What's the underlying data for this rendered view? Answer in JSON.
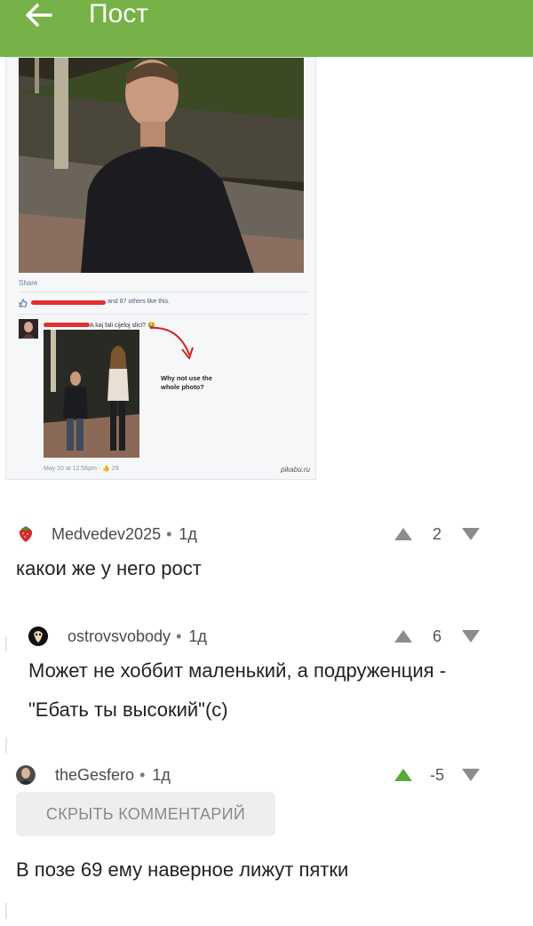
{
  "appbar": {
    "title": "Пост",
    "back_icon": "arrow-left-icon",
    "color": "#76b247"
  },
  "post_image": {
    "share_label": "Share",
    "like_text": "and 87 others like this.",
    "fb_comment": "A kaj fali cijeloj slici? 😂",
    "fb_meta": "May 10 at 12:56pm · 👍 29",
    "annotation": "Why not use the whole photo?",
    "watermark": "pikabu.ru"
  },
  "comments": [
    {
      "author": "Medvedev2025",
      "time": "1д",
      "score": "2",
      "text": "какои же у него рост",
      "avatar_icon": "strawberry-icon",
      "upvoted": false
    },
    {
      "author": "ostrovsvobody",
      "time": "1д",
      "score": "6",
      "text_line1": "Может не хоббит маленький, а подруженция -",
      "text_line2": "\"Ебать ты высокий\"(с)",
      "avatar_icon": "user-avatar-icon",
      "upvoted": false
    },
    {
      "author": "theGesfero",
      "time": "1д",
      "score": "-5",
      "hide_label": "СКРЫТЬ КОММЕНТАРИЙ",
      "text": "В позе 69 ему наверное лижут пятки",
      "avatar_icon": "user-avatar-icon",
      "upvoted": true
    }
  ],
  "colors": {
    "upvote_active": "#5aa83a",
    "vote_inactive": "#8c8c8c"
  }
}
